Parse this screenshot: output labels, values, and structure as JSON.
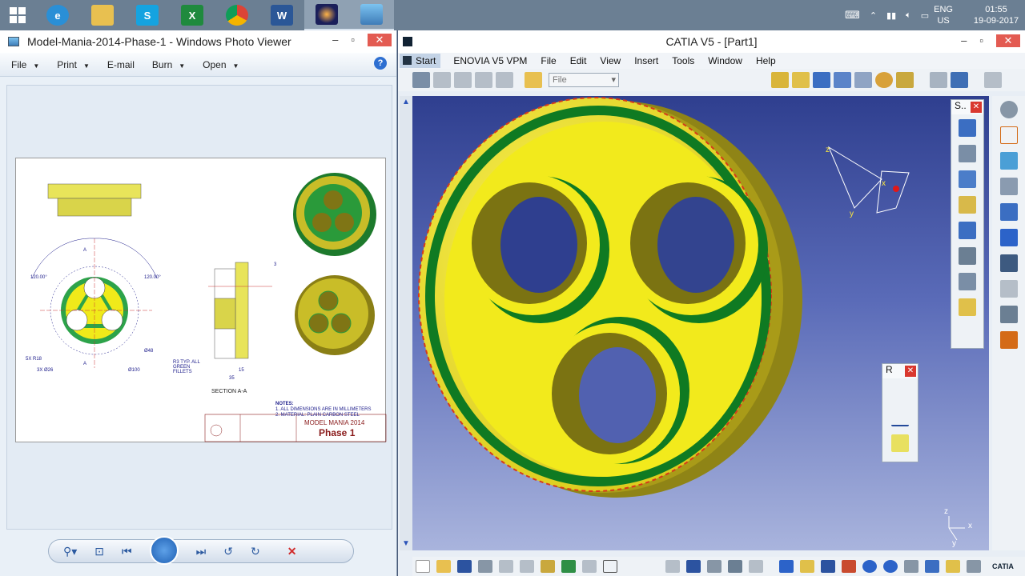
{
  "taskbar": {
    "apps": [
      "windows-start",
      "internet-explorer",
      "file-explorer",
      "skype",
      "excel",
      "chrome",
      "word",
      "catia",
      "photo-viewer"
    ],
    "language": "ENG",
    "region": "US",
    "time": "01:55",
    "date": "19-09-2017"
  },
  "photo_viewer": {
    "title": "Model-Mania-2014-Phase-1 - Windows Photo Viewer",
    "menu": [
      "File",
      "Print",
      "E-mail",
      "Burn",
      "Open"
    ],
    "drawing": {
      "title_line1": "MODEL MANIA 2014",
      "title_line2": "Phase 1",
      "notes_header": "NOTES:",
      "note1": "1. ALL DIMENSIONS ARE IN MILLIMETERS",
      "note2": "2. MATERIAL: PLAIN CARBON STEEL",
      "section_label": "SECTION A-A",
      "label_a_top": "A",
      "label_a_bottom": "A",
      "dim_diam48": "Ø48",
      "dim_diam100": "Ø100",
      "dim_r5": "5X R18",
      "dim_d26": "3X Ø26",
      "dim_15": "15",
      "dim_35": "35",
      "dim_3": "3",
      "dim_fillets": "R3 TYP. ALL GREEN FILLETS",
      "angle1": "120.00°",
      "angle2": "120.00°"
    }
  },
  "catia": {
    "title": "CATIA V5 - [Part1]",
    "menu": [
      "Start",
      "ENOVIA V5 VPM",
      "File",
      "Edit",
      "View",
      "Insert",
      "Tools",
      "Window",
      "Help"
    ],
    "file_combo": "File",
    "float_toolbar_s": "S..",
    "float_toolbar_r": "R",
    "axis_x": "x",
    "axis_y": "y",
    "axis_z": "z",
    "brand": "CATIA",
    "colors": {
      "part_yellow": "#f2ea1c",
      "part_shadow": "#9e8f18",
      "fillet_green": "#0f7a22",
      "background_top": "#2f3f8f",
      "background_bottom": "#a9b4dd"
    }
  }
}
